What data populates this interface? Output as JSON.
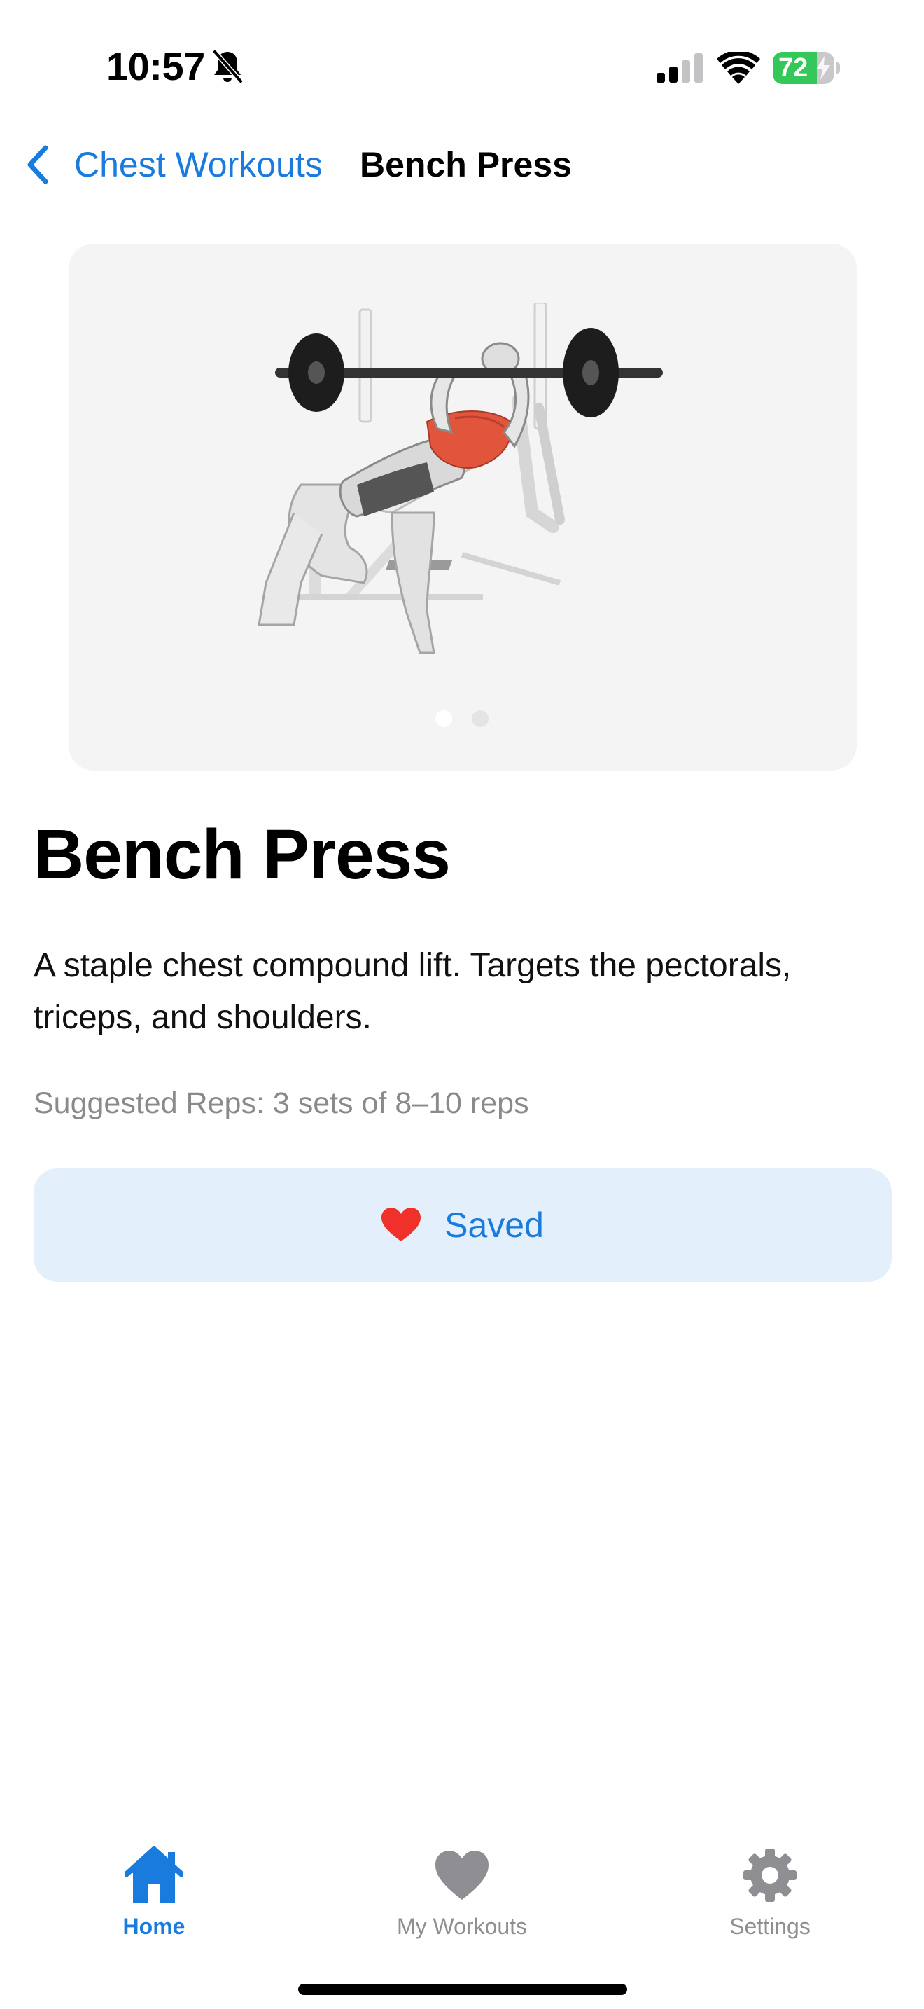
{
  "status_bar": {
    "time": "10:57",
    "battery_percent": "72",
    "battery_level": 0.72,
    "icons": [
      "bell-slash-icon",
      "signal-icon",
      "wifi-icon",
      "battery-icon",
      "bolt-icon"
    ],
    "battery_color": "#34c759"
  },
  "nav": {
    "back_label": "Chest Workouts",
    "title": "Bench Press",
    "back_icon": "chevron-left-icon",
    "accent_color": "#1a7bde"
  },
  "media": {
    "illustration": "bench-press-illustration",
    "page_count": 2,
    "current_page": 1
  },
  "exercise": {
    "title": "Bench Press",
    "description": "A staple chest compound lift. Targets the pectorals, triceps, and shoulders.",
    "suggested_reps": "Suggested Reps: 3 sets of 8–10 reps"
  },
  "save_button": {
    "label": "Saved",
    "icon": "heart-red-icon",
    "background": "#e3effb",
    "heart_color": "#f0302a"
  },
  "tabs": [
    {
      "label": "Home",
      "icon": "house-icon",
      "selected": true
    },
    {
      "label": "My Workouts",
      "icon": "heart-icon",
      "selected": false
    },
    {
      "label": "Settings",
      "icon": "gear-icon",
      "selected": false
    }
  ]
}
